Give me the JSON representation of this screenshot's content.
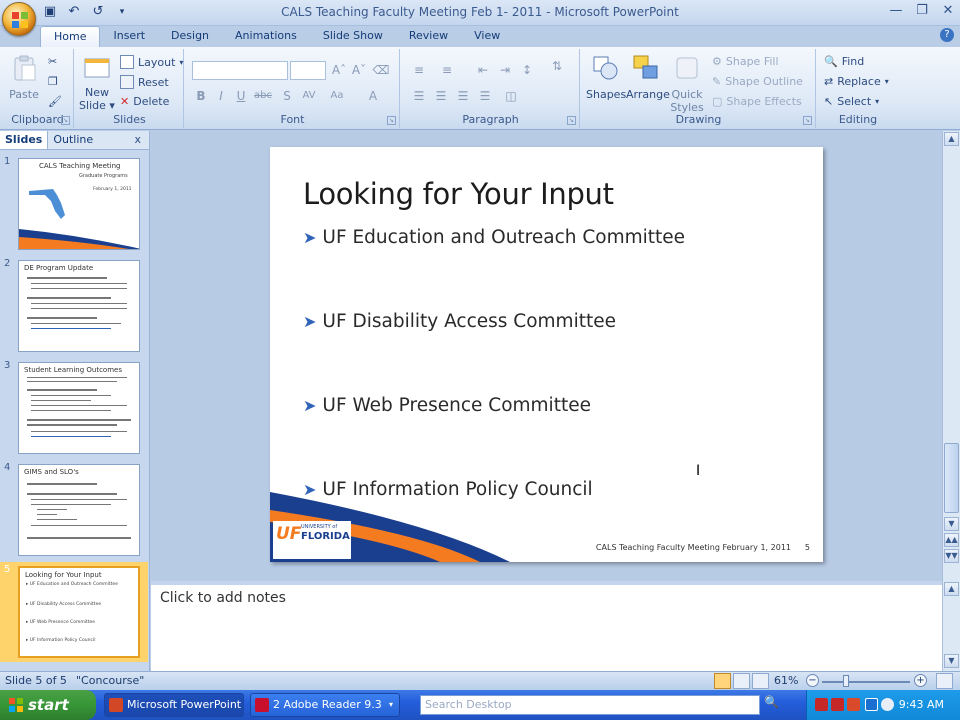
{
  "window": {
    "title": "CALS Teaching Faculty Meeting Feb 1- 2011 - Microsoft PowerPoint"
  },
  "tabs": [
    "Home",
    "Insert",
    "Design",
    "Animations",
    "Slide Show",
    "Review",
    "View"
  ],
  "ribbon": {
    "clipboard": {
      "label": "Clipboard",
      "paste": "Paste"
    },
    "slides": {
      "label": "Slides",
      "new_slide_1": "New",
      "new_slide_2": "Slide",
      "layout": "Layout",
      "reset": "Reset",
      "delete": "Delete"
    },
    "font": {
      "label": "Font"
    },
    "paragraph": {
      "label": "Paragraph"
    },
    "drawing": {
      "label": "Drawing",
      "shapes": "Shapes",
      "arrange": "Arrange",
      "quick_styles_1": "Quick",
      "quick_styles_2": "Styles",
      "shape_fill": "Shape Fill",
      "shape_outline": "Shape Outline",
      "shape_effects": "Shape Effects"
    },
    "editing": {
      "label": "Editing",
      "find": "Find",
      "replace": "Replace",
      "select": "Select"
    }
  },
  "left_pane": {
    "tab_slides": "Slides",
    "tab_outline": "Outline",
    "close": "x",
    "thumbnails": [
      {
        "num": "1",
        "title": "CALS Teaching Meeting",
        "sub": "Graduate Programs",
        "date": "February 1, 2011"
      },
      {
        "num": "2",
        "title": "DE Program Update"
      },
      {
        "num": "3",
        "title": "Student Learning Outcomes"
      },
      {
        "num": "4",
        "title": "GIMS and SLO's"
      },
      {
        "num": "5",
        "title": "Looking for Your Input",
        "lines": [
          "UF Education and Outreach Committee",
          "UF Disability Access Committee",
          "UF Web Presence Committee",
          "UF Information Policy Council"
        ]
      }
    ]
  },
  "slide": {
    "title": "Looking for Your Input",
    "bullets": [
      "UF Education and Outreach Committee",
      "UF Disability Access Committee",
      "UF Web Presence Committee",
      "UF Information Policy Council"
    ],
    "footer": "CALS Teaching Faculty Meeting February 1, 2011",
    "number": "5",
    "logo_text_1": "UNIVERSITY of",
    "logo_text_2": "FLORIDA"
  },
  "notes": {
    "placeholder": "Click to add notes"
  },
  "status": {
    "slide": "Slide 5 of 5",
    "theme": "\"Concourse\"",
    "zoom": "61%"
  },
  "taskbar": {
    "start": "start",
    "tasks": [
      "Microsoft PowerPoint ...",
      "2 Adobe Reader 9.3"
    ],
    "search_placeholder": "Search Desktop",
    "clock": "9:43 AM"
  },
  "colors": {
    "accent_blue": "#2f63b6",
    "uf_orange": "#f47b20",
    "uf_blue": "#1b3f8f"
  }
}
